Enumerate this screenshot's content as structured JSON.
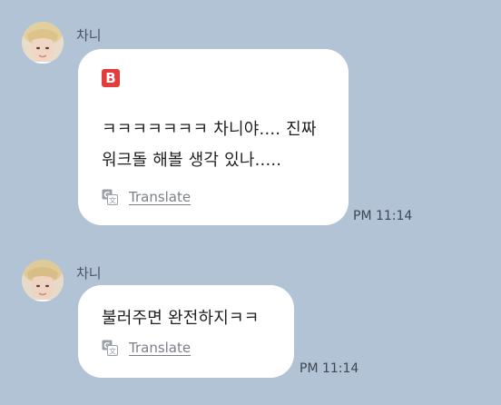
{
  "messages": [
    {
      "sender": "차니",
      "badge": "B",
      "text": "ㅋㅋㅋㅋㅋㅋㅋ 차니야.... 진짜\n워크돌 해볼 생각 있나.....",
      "translate_label": "Translate",
      "time": "PM 11:14"
    },
    {
      "sender": "차니",
      "text": "불러주면 완전하지ㅋㅋ",
      "translate_label": "Translate",
      "time": "PM 11:14"
    }
  ],
  "colors": {
    "background": "#b2c3d6",
    "bubble": "#ffffff",
    "badge": "#e23c3c"
  },
  "icons": [
    "avatar",
    "translate-icon"
  ]
}
